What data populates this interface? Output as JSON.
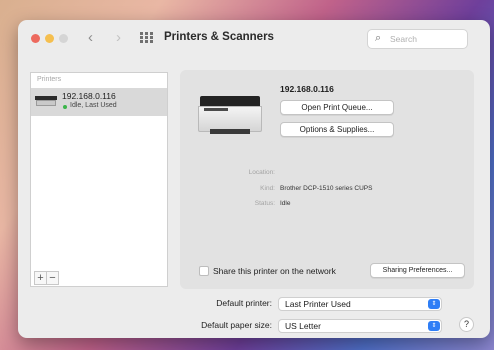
{
  "window": {
    "title": "Printers & Scanners",
    "nav_back": "‹",
    "nav_forward": "›",
    "search_icon": "⌕",
    "search_placeholder": "Search"
  },
  "sidebar": {
    "header": "Printers",
    "items": [
      {
        "name": "192.168.0.116",
        "status": "Idle, Last Used",
        "status_color": "#3bb54a"
      }
    ],
    "add_label": "+",
    "remove_label": "−"
  },
  "detail": {
    "printer_name": "192.168.0.116",
    "open_queue_label": "Open Print Queue...",
    "options_label": "Options & Supplies...",
    "info": [
      {
        "label": "Location:",
        "value": ""
      },
      {
        "label": "Kind:",
        "value": "Brother DCP-1510 series CUPS"
      },
      {
        "label": "Status:",
        "value": "Idle"
      }
    ],
    "share_label": "Share this printer on the network",
    "sharing_prefs_label": "Sharing Preferences..."
  },
  "footer": {
    "default_printer_label": "Default printer:",
    "default_printer_value": "Last Printer Used",
    "default_paper_label": "Default paper size:",
    "default_paper_value": "US Letter",
    "popup_arrow": "⇕",
    "help_label": "?"
  },
  "colors": {
    "accent": "#2f7ef6",
    "close": "#ed6a5e",
    "minimize": "#f5bf4f",
    "status_idle": "#3bb54a"
  }
}
